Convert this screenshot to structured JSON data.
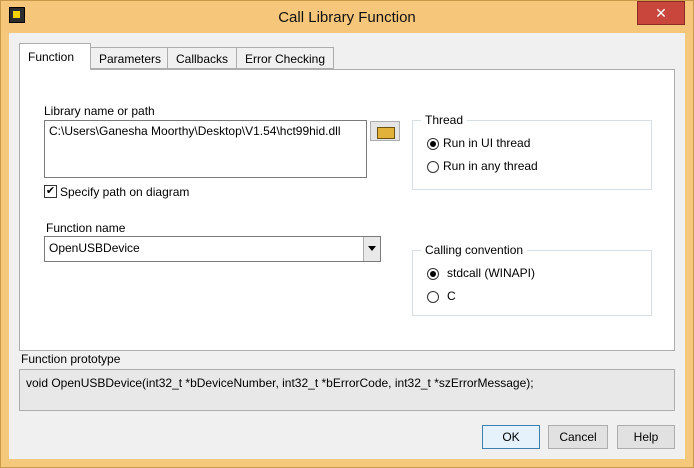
{
  "window": {
    "title": "Call Library Function",
    "close_label": "✕"
  },
  "tabs": [
    "Function",
    "Parameters",
    "Callbacks",
    "Error Checking"
  ],
  "function_tab": {
    "library_label": "Library name or path",
    "library_path": "C:\\Users\\Ganesha Moorthy\\Desktop\\V1.54\\hct99hid.dll",
    "specify_path_label": "Specify path on diagram",
    "specify_path_checked": true,
    "function_name_label": "Function name",
    "function_name": "OpenUSBDevice",
    "thread_group": {
      "title": "Thread",
      "options": [
        "Run in UI thread",
        "Run in any thread"
      ],
      "selected": 0
    },
    "calling_group": {
      "title": "Calling convention",
      "options": [
        "stdcall (WINAPI)",
        "C"
      ],
      "selected": 0
    }
  },
  "prototype": {
    "label": "Function prototype",
    "text": "void  OpenUSBDevice(int32_t *bDeviceNumber, int32_t *bErrorCode, int32_t *szErrorMessage);"
  },
  "buttons": {
    "ok": "OK",
    "cancel": "Cancel",
    "help": "Help"
  },
  "checkmark": "✔"
}
